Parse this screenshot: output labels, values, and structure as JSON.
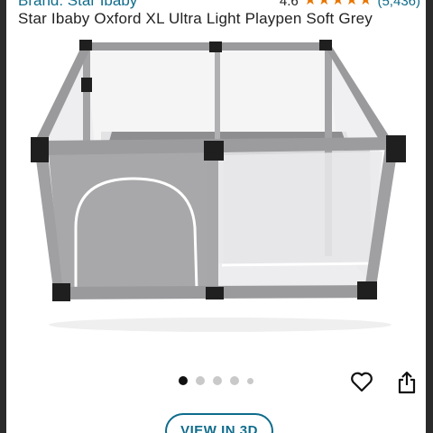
{
  "header": {
    "brand_label": "Brand: Star Ibaby",
    "rating_value": "4.6",
    "rating_stars": 4.5,
    "review_count": "(5,436)"
  },
  "product": {
    "title": "Star Ibaby Oxford XL Ultra Light Playpen Soft Grey",
    "image_alt": "Grey square mesh playpen with zippered door"
  },
  "gallery": {
    "image_count": 5,
    "active_index": 0
  },
  "actions": {
    "wishlist_icon": "heart-icon",
    "share_icon": "share-icon",
    "view_3d_label": "VIEW IN 3D"
  },
  "colors": {
    "link": "#0f6c8c",
    "star": "#e77600",
    "frame": "#9a9a9a"
  }
}
